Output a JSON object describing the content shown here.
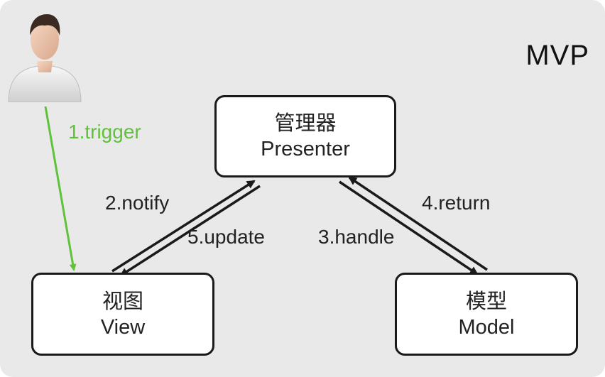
{
  "title": "MVP",
  "nodes": {
    "presenter": {
      "zh": "管理器",
      "en": "Presenter"
    },
    "view": {
      "zh": "视图",
      "en": "View"
    },
    "model": {
      "zh": "模型",
      "en": "Model"
    }
  },
  "edges": {
    "trigger": "1.trigger",
    "notify": "2.notify",
    "handle": "3.handle",
    "return": "4.return",
    "update": "5.update"
  },
  "colors": {
    "trigger": "#5fc23a",
    "line": "#1a1a1a",
    "background": "#e9e9e9"
  },
  "icons": {
    "user": "user-avatar-icon"
  }
}
